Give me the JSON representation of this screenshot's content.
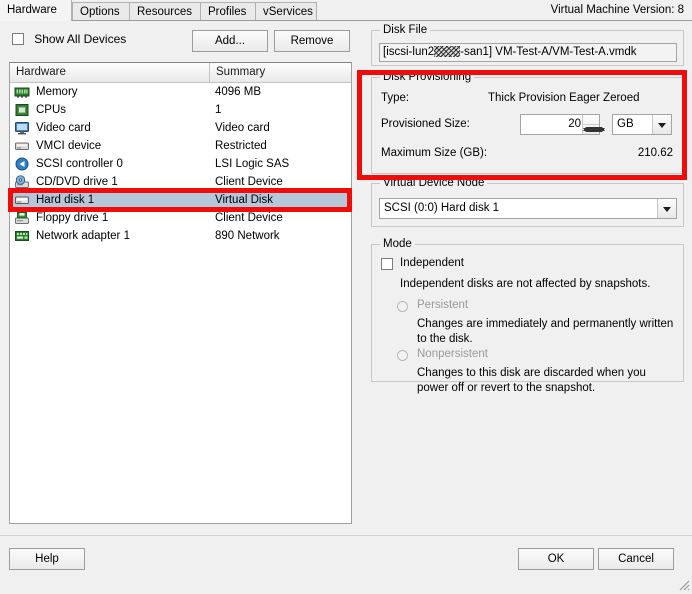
{
  "window": {
    "vm_version": "Virtual Machine Version: 8"
  },
  "tabs": [
    {
      "label": "Hardware",
      "active": true
    },
    {
      "label": "Options",
      "active": false
    },
    {
      "label": "Resources",
      "active": false
    },
    {
      "label": "Profiles",
      "active": false
    },
    {
      "label": "vServices",
      "active": false
    }
  ],
  "toolbar": {
    "show_all_devices_label": "Show All Devices",
    "show_all_devices_checked": false,
    "add_label": "Add...",
    "remove_label": "Remove"
  },
  "hardware_list": {
    "columns": [
      "Hardware",
      "Summary"
    ],
    "rows": [
      {
        "icon": "memory-icon",
        "name": "Memory",
        "summary": "4096 MB",
        "selected": false
      },
      {
        "icon": "cpu-icon",
        "name": "CPUs",
        "summary": "1",
        "selected": false
      },
      {
        "icon": "video-card-icon",
        "name": "Video card",
        "summary": "Video card",
        "selected": false
      },
      {
        "icon": "vmci-device-icon",
        "name": "VMCI device",
        "summary": "Restricted",
        "selected": false
      },
      {
        "icon": "scsi-controller-icon",
        "name": "SCSI controller 0",
        "summary": "LSI Logic SAS",
        "selected": false
      },
      {
        "icon": "cddvd-drive-icon",
        "name": "CD/DVD drive 1",
        "summary": "Client Device",
        "selected": false
      },
      {
        "icon": "hard-disk-icon",
        "name": "Hard disk 1",
        "summary": "Virtual Disk",
        "selected": true
      },
      {
        "icon": "floppy-drive-icon",
        "name": "Floppy drive 1",
        "summary": "Client Device",
        "selected": false
      },
      {
        "icon": "network-adapter-icon",
        "name": "Network adapter 1",
        "summary": "890 Network",
        "selected": false
      }
    ]
  },
  "disk_file": {
    "legend": "Disk File",
    "prefix": "[iscsi-lun2",
    "suffix": "-san1] VM-Test-A/VM-Test-A.vmdk"
  },
  "disk_provisioning": {
    "legend": "Disk Provisioning",
    "type_label": "Type:",
    "type_value": "Thick Provision Eager Zeroed",
    "size_label": "Provisioned Size:",
    "size_value": "20",
    "size_units": "GB",
    "max_label": "Maximum Size (GB):",
    "max_value": "210.62"
  },
  "virtual_device_node": {
    "legend": "Virtual Device Node",
    "value": "SCSI (0:0) Hard disk 1"
  },
  "mode": {
    "legend": "Mode",
    "independent_label": "Independent",
    "independent_checked": false,
    "independent_desc": "Independent disks are not affected by snapshots.",
    "persistent_label": "Persistent",
    "persistent_desc": "Changes are immediately and permanently written to the disk.",
    "nonpersistent_label": "Nonpersistent",
    "nonpersistent_desc": "Changes to this disk are discarded when you power off or revert to the snapshot."
  },
  "footer": {
    "help_label": "Help",
    "ok_label": "OK",
    "cancel_label": "Cancel"
  },
  "annotations": {
    "highlight_color": "#f10c0c"
  }
}
